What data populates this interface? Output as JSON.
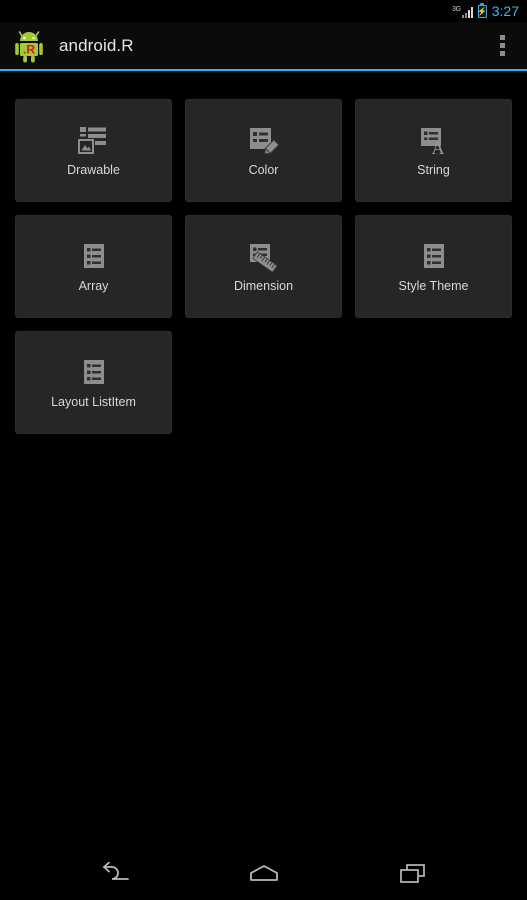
{
  "status_bar": {
    "network_type": "3G",
    "signal_icon": "signal-bars-icon",
    "battery_icon": "battery-charging-icon",
    "time": "3:27",
    "accent_color": "#33b5e5"
  },
  "action_bar": {
    "app_icon": "android-robot-r-icon",
    "title": "android.R",
    "overflow_icon": "overflow-menu-icon",
    "divider_color": "#33b5e5"
  },
  "grid": {
    "tiles": [
      {
        "label": "Drawable",
        "icon": "drawable-image-list-icon"
      },
      {
        "label": "Color",
        "icon": "color-pen-document-icon"
      },
      {
        "label": "String",
        "icon": "string-letter-a-document-icon"
      },
      {
        "label": "Array",
        "icon": "array-list-document-icon"
      },
      {
        "label": "Dimension",
        "icon": "dimension-ruler-document-icon"
      },
      {
        "label": "Style Theme",
        "icon": "style-theme-list-document-icon"
      },
      {
        "label": "Layout ListItem",
        "icon": "layout-listitem-list-document-icon"
      }
    ]
  },
  "nav_bar": {
    "back_label": "Back",
    "home_label": "Home",
    "recents_label": "Recent apps",
    "back_icon": "back-arrow-icon",
    "home_icon": "home-icon",
    "recents_icon": "recent-apps-icon"
  }
}
